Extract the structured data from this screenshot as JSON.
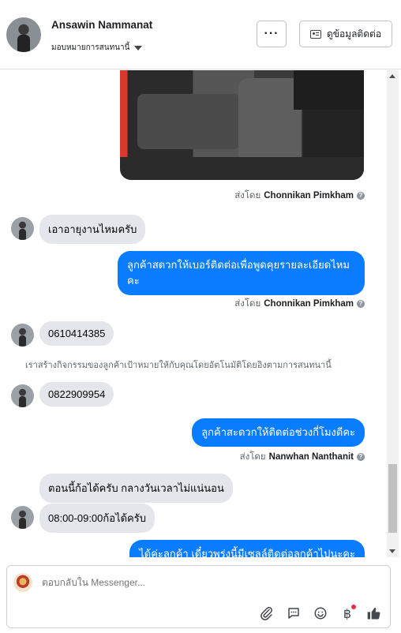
{
  "header": {
    "name": "Ansawin Nammanat",
    "assign_label": "มอบหมายการสนทนานี้",
    "more_label": "···",
    "contact_label": "ดูข้อมูลติดต่อ"
  },
  "messages": [
    {
      "kind": "sent_by",
      "prefix": "ส่งโดย",
      "name": "Chonnikan Pimkham"
    },
    {
      "kind": "incoming",
      "text": "เอาอายุงานไหมครับ"
    },
    {
      "kind": "outgoing",
      "text": "ลูกค้าสดวกให้เบอร์ติดต่อเพื่อพูดคุยรายละเอียดไหมคะ"
    },
    {
      "kind": "sent_by",
      "prefix": "ส่งโดย",
      "name": "Chonnikan Pimkham"
    },
    {
      "kind": "incoming",
      "text": "0610414385"
    },
    {
      "kind": "system",
      "text": "เราสร้างกิจกรรมของลูกค้าเป้าหมายให้กับคุณโดยอัตโนมัติโดยอิงตามการสนทนานี้"
    },
    {
      "kind": "incoming",
      "text": "0822909954"
    },
    {
      "kind": "outgoing",
      "text": "ลูกค้าสะดวกให้ติดต่อช่วงกี่โมงดีคะ"
    },
    {
      "kind": "sent_by",
      "prefix": "ส่งโดย",
      "name": "Nanwhan Nanthanit"
    },
    {
      "kind": "incoming",
      "text": "ตอนนี้ก้อได้ครับ กลางวันเวลาไม่แน่นอน"
    },
    {
      "kind": "incoming",
      "text": "08:00-09:00ก้อได้ครับ"
    },
    {
      "kind": "outgoing",
      "text": "ได้ค่ะลูกค้า เดี๋ยวพรุ่งนี้มีเซลล์ติดต่อลูกค้าไปนะคะ"
    }
  ],
  "composer": {
    "placeholder": "ตอบกลับใน Messenger..."
  },
  "icons": [
    "more-icon",
    "contact-card-icon",
    "help-icon",
    "attach-icon",
    "saved-reply-icon",
    "emoji-icon",
    "baht-icon",
    "thumbs-up-icon"
  ],
  "colors": {
    "outgoing_bubble": "#0a7cff",
    "incoming_bubble": "#e4e6eb",
    "notification_dot": "#f02849"
  }
}
